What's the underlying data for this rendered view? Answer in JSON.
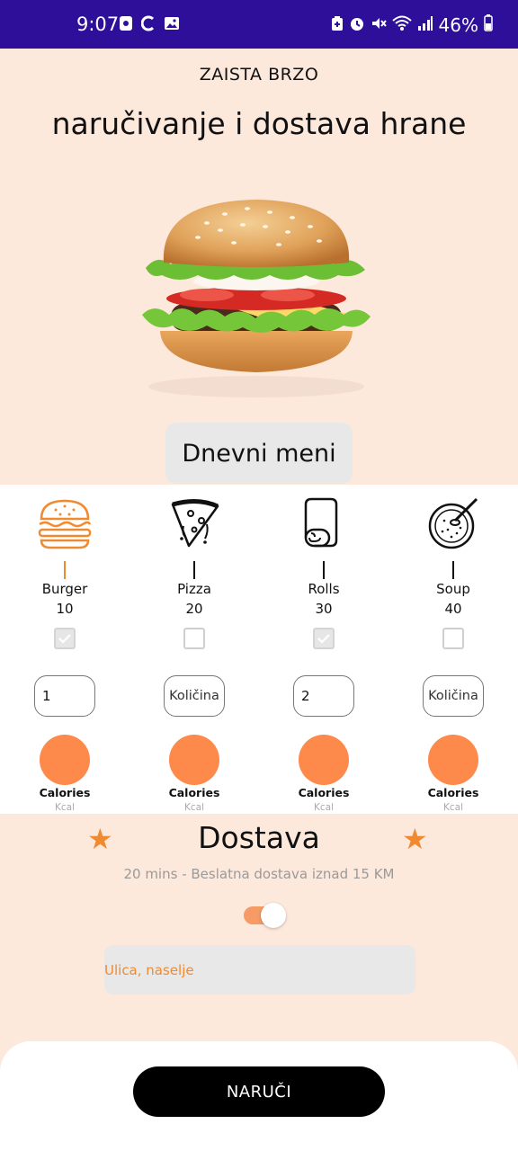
{
  "status_bar": {
    "time": "9:07",
    "battery": "46%",
    "left_icons": [
      "app-notification-icon",
      "c-notification-icon",
      "image-notification-icon"
    ],
    "right_icons": [
      "battery-saver-icon",
      "alarm-icon",
      "mute-icon",
      "wifi-icon",
      "signal-icon",
      "battery-icon"
    ]
  },
  "header": {
    "subtitle": "ZAISTA BRZO",
    "title": "naručivanje i dostava hrane"
  },
  "menu_button": {
    "label": "Dnevni meni"
  },
  "menu_items": [
    {
      "name": "Burger",
      "price": "10",
      "checked": true,
      "quantity": "1",
      "quantity_placeholder": "Količina",
      "calories_label": "Calories",
      "calories_unit": "Kcal",
      "icon": "burger-icon"
    },
    {
      "name": "Pizza",
      "price": "20",
      "checked": false,
      "quantity": "",
      "quantity_placeholder": "Količina",
      "calories_label": "Calories",
      "calories_unit": "Kcal",
      "icon": "pizza-icon"
    },
    {
      "name": "Rolls",
      "price": "30",
      "checked": true,
      "quantity": "2",
      "quantity_placeholder": "Količina",
      "calories_label": "Calories",
      "calories_unit": "Kcal",
      "icon": "rolls-icon"
    },
    {
      "name": "Soup",
      "price": "40",
      "checked": false,
      "quantity": "",
      "quantity_placeholder": "Količina",
      "calories_label": "Calories",
      "calories_unit": "Kcal",
      "icon": "soup-icon"
    }
  ],
  "delivery": {
    "title": "Dostava",
    "info": "20 mins - Beslatna dostava iznad 15 KM",
    "toggle_on": true,
    "address_placeholder": "Ulica, naselje"
  },
  "order_button": {
    "label": "NARUČI"
  },
  "colors": {
    "status_bar": "#2e0f9a",
    "background": "#fde8dc",
    "accent": "#fd8a4a",
    "star": "#f08a30"
  }
}
